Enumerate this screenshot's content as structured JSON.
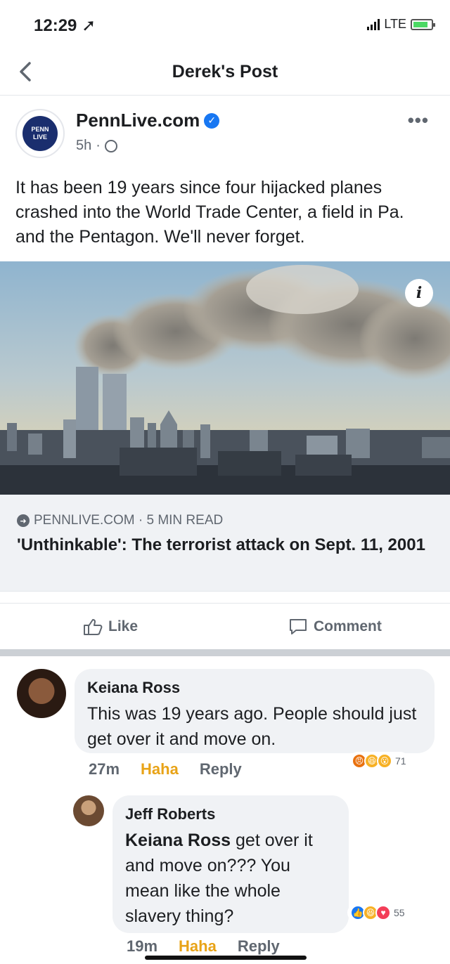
{
  "status_bar": {
    "time": "12:29",
    "network": "LTE"
  },
  "nav": {
    "title": "Derek's Post",
    "back_icon": "chevron-left-icon"
  },
  "post": {
    "page_name": "PennLive.com",
    "avatar_text_top": "PENN",
    "avatar_text_bottom": "LIVE",
    "time": "5h",
    "text": "It has been 19 years since four hijacked planes crashed into the World Trade Center, a field in Pa. and the Pentagon. We'll never forget.",
    "info_label": "i",
    "link": {
      "source": "PENNLIVE.COM · 5 MIN READ",
      "title": "'Unthinkable': The terrorist attack on Sept. 11, 2001"
    },
    "actions": {
      "like": "Like",
      "comment": "Comment"
    }
  },
  "comments": [
    {
      "name": "Keiana Ross",
      "text": "This was 19 years ago. People should just get over it and move on.",
      "time": "27m",
      "reaction_label": "Haha",
      "reply_label": "Reply",
      "reaction_count": "71"
    },
    {
      "name": "Jeff Roberts",
      "mention": "Keiana Ross",
      "text": " get over it and move on??? You mean like the whole slavery thing?",
      "time": "19m",
      "reaction_label": "Haha",
      "reply_label": "Reply",
      "reaction_count": "55"
    }
  ],
  "colors": {
    "accent": "#1877f2",
    "haha": "#e8a317",
    "bubble": "#f0f2f5"
  }
}
